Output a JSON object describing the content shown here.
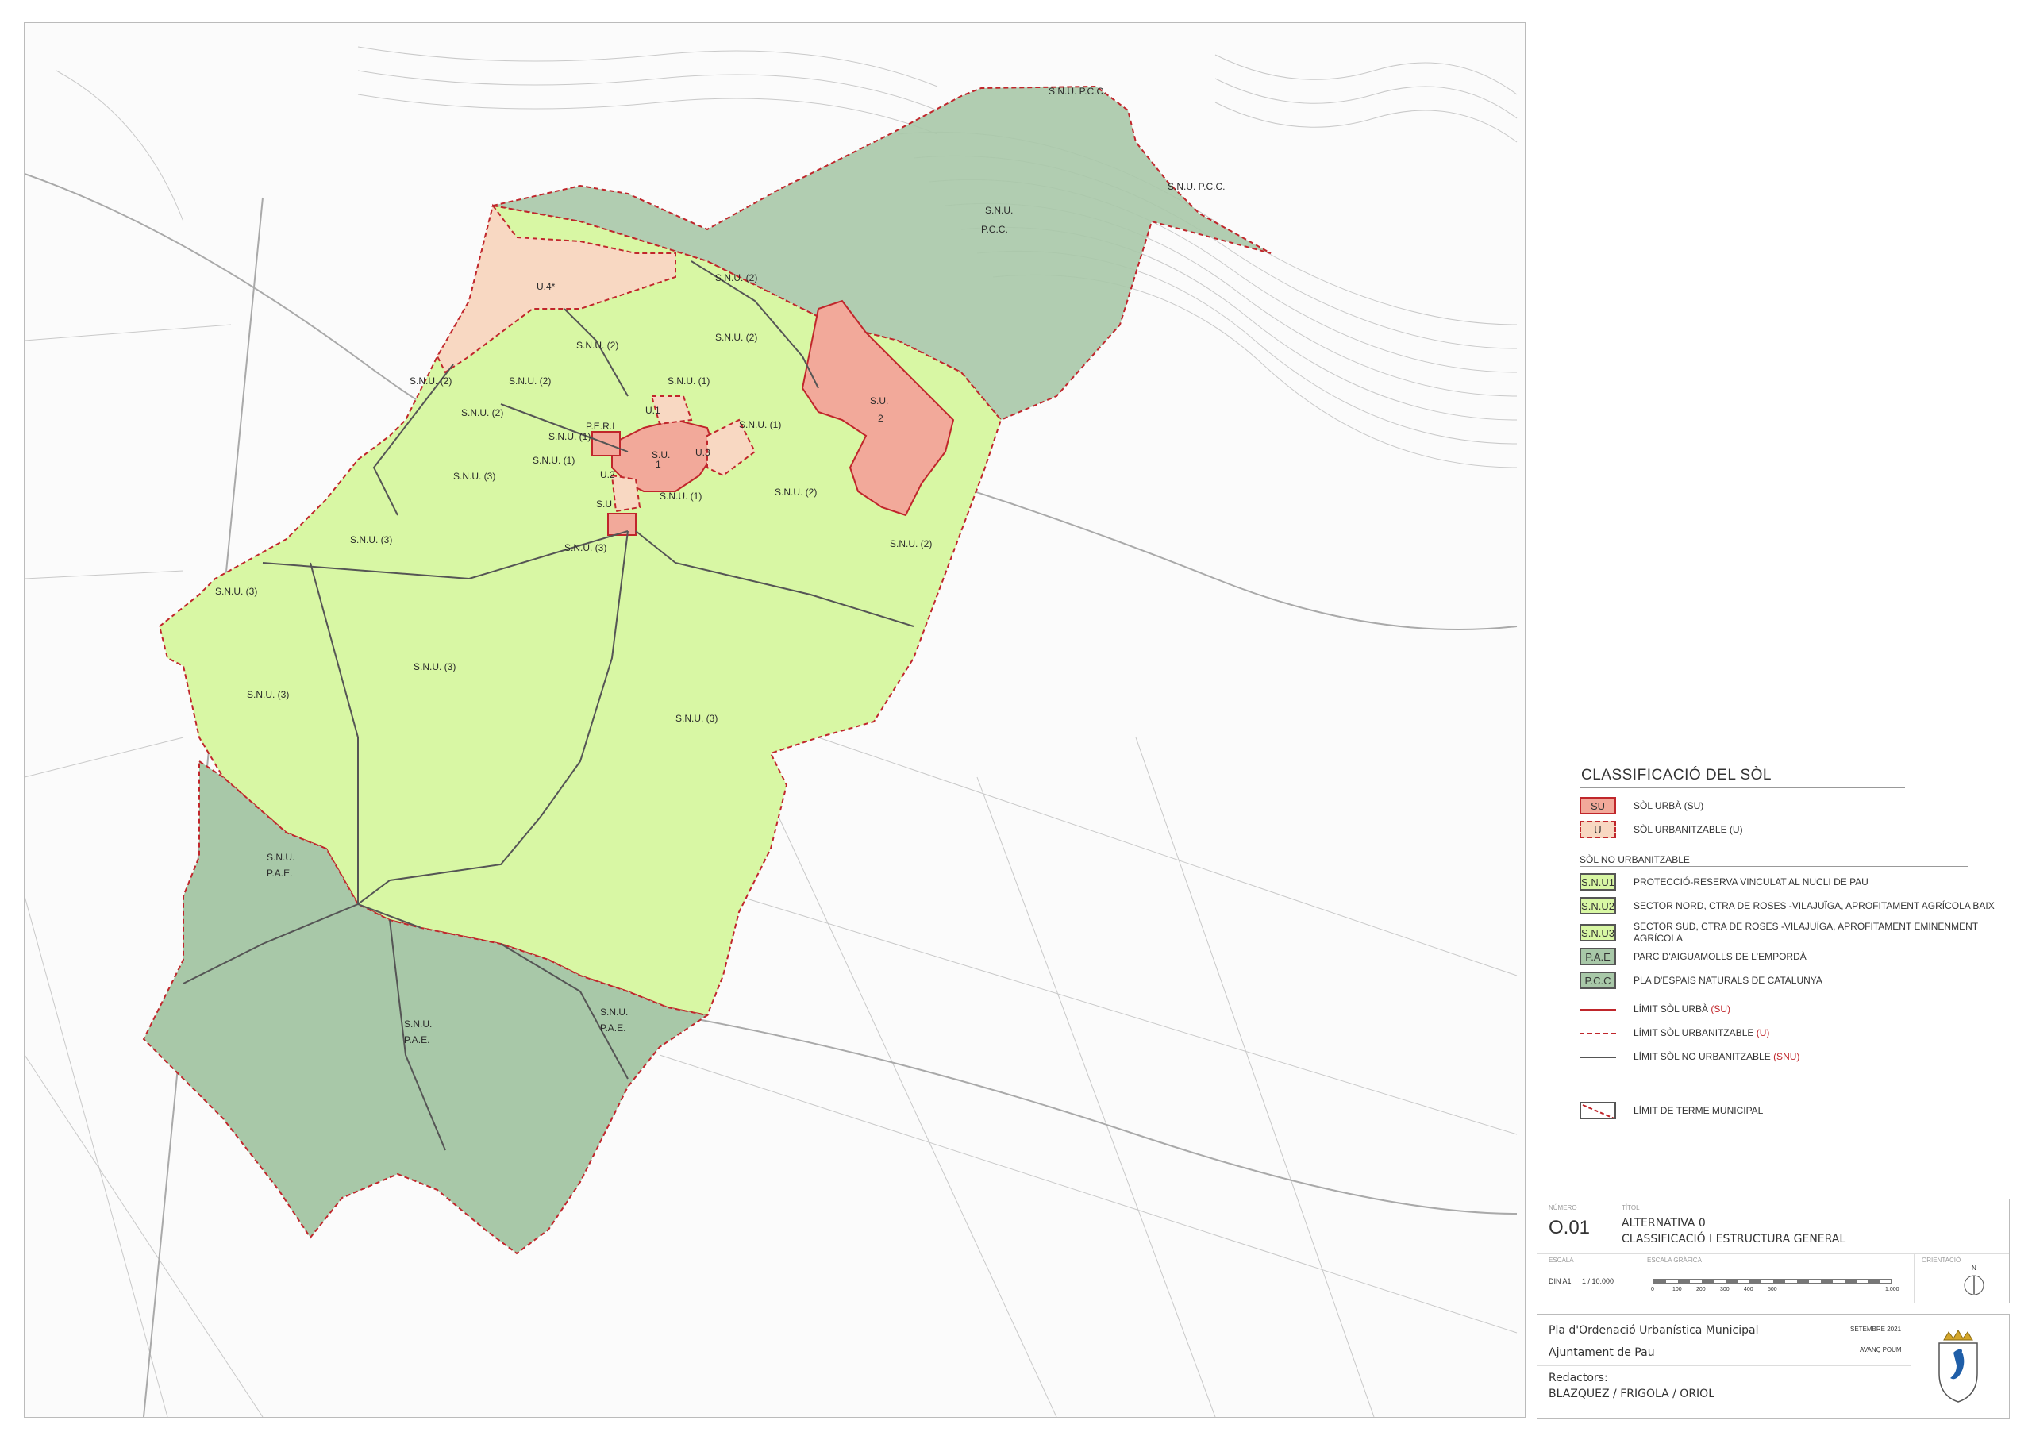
{
  "map": {
    "zone_labels": {
      "snu_pcc_top": "S.N.U. P.C.C.",
      "snu_pcc_top2": "S.N.U. P.C.C.",
      "snu_label": "S.N.U.",
      "pcc_label": "P.C.C.",
      "u4": "U.4*",
      "snu2": "S.N.U. (2)",
      "snu1": "S.N.U. (1)",
      "snu3": "S.N.U. (3)",
      "su": "S.U.",
      "su_num": "2",
      "su1_num": "1",
      "u1": "U.1",
      "u2": "U.2",
      "u3": "U.3",
      "peri": "P.E.R.I",
      "su_small": "S.U",
      "pae": "P.A.E."
    }
  },
  "legend": {
    "title": "CLASSIFICACIÓ DEL SÒL",
    "items_top": [
      {
        "code": "SU",
        "label": "SÒL URBÀ (SU)",
        "fill": "#f2a99a",
        "border": "#c0262b"
      },
      {
        "code": "U",
        "label": "SÒL URBANITZABLE (U)",
        "fill": "#f8d8c2",
        "border": "#c0262b"
      }
    ],
    "subhead": "SÒL NO URBANITZABLE",
    "items_snu": [
      {
        "code": "S.N.U1",
        "label": "PROTECCIÓ-RESERVA VINCULAT AL NUCLI DE PAU",
        "fill": "#d8f7a4"
      },
      {
        "code": "S.N.U2",
        "label": "SECTOR NORD, CTRA DE ROSES -VILAJUÏGA, APROFITAMENT AGRÍCOLA BAIX",
        "fill": "#d8f7a4"
      },
      {
        "code": "S.N.U3",
        "label": "SECTOR SUD, CTRA DE ROSES -VILAJUÏGA, APROFITAMENT EMINENMENT AGRÍCOLA",
        "fill": "#d8f7a4"
      },
      {
        "code": "P.A.E",
        "label": "PARC D'AIGUAMOLLS DE L'EMPORDÀ",
        "fill": "#a8c8a8"
      },
      {
        "code": "P.C.C",
        "label": "PLA D'ESPAIS NATURALS DE CATALUNYA",
        "fill": "#a8c8a8"
      }
    ],
    "lines": [
      {
        "label": "LÍMIT SÒL URBÀ",
        "code": "(SU)"
      },
      {
        "label": "LÍMIT SÒL URBANITZABLE",
        "code": "(U)"
      },
      {
        "label": "LÍMIT SÒL NO URBANITZABLE",
        "code": "(SNU)"
      }
    ],
    "municipal": "LÍMIT DE TERME MUNICIPAL"
  },
  "title_block": {
    "numero_caption": "NÚMERO",
    "numero": "O.01",
    "titol_caption": "TÍTOL",
    "titol_line1": "ALTERNATIVA 0",
    "titol_line2": "CLASSIFICACIÓ I ESTRUCTURA GENERAL",
    "escala_caption": "ESCALA",
    "format": "DIN A1",
    "escala": "1 / 10.000",
    "escala_grafica_caption": "ESCALA GRÀFICA",
    "scale_ticks": [
      "0",
      "100",
      "200",
      "300",
      "400",
      "500",
      "1.000"
    ],
    "orientacio_caption": "ORIENTACIÓ",
    "north": "N",
    "plan_name": "Pla d'Ordenació Urbanística Municipal",
    "council": "Ajuntament de Pau",
    "date": "SETEMBRE 2021",
    "phase": "AVANÇ POUM",
    "authors_caption": "Redactors:",
    "authors": "BLAZQUEZ / FRIGOLA / ORIOL"
  },
  "colors": {
    "su": "#f2a99a",
    "u": "#f8d8c2",
    "snu": "#d8f7a4",
    "protected": "#a8c8a8",
    "limit_red": "#c0262b",
    "limit_dark": "#555555"
  }
}
